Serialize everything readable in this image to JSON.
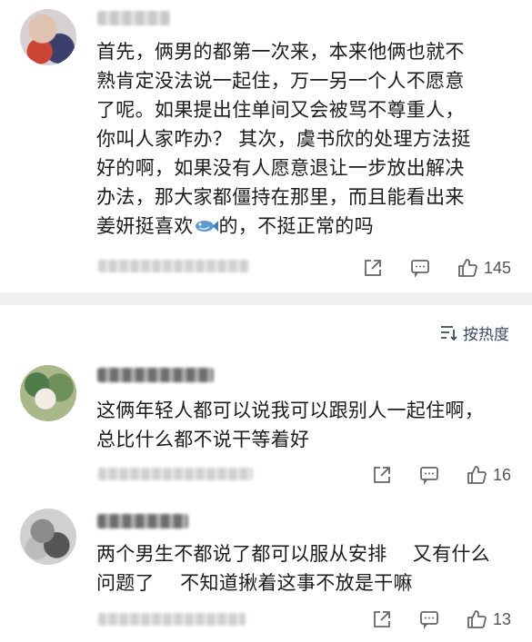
{
  "comments": [
    {
      "username": "██████",
      "text": "首先，俩男的都第一次来，本来他俩也就不\n熟肯定没法说一起住，万一另一个人不愿意\n了呢。如果提出住单间又会被骂不尊重人，\n你叫人家咋办？ 其次，虞书欣的处理方法挺\n好的啊，如果没有人愿意退让一步放出解决\n办法，那大家都僵持在那里，而且能看出来\n姜妍挺喜欢",
      "text_after_emoji": "的，不挺正常的吗",
      "emoji": "fish-emoji",
      "meta": "███████████",
      "likes": "145"
    },
    {
      "username": "███████",
      "text": "这俩年轻人都可以说我可以跟别人一起住啊，\n总比什么都不说干等着好",
      "meta": "████████████",
      "likes": "16"
    },
    {
      "username": "█████",
      "text": "两个男生不都说了都可以服从安排　 又有什么\n问题了　 不知道揪着这事不放是干嘛",
      "meta": "█████████",
      "likes": "13"
    }
  ],
  "sort": {
    "label": "按热度",
    "icon": "sort-icon"
  },
  "icons": {
    "share": "share-icon",
    "reply": "comment-icon",
    "like": "thumbs-up-icon"
  },
  "colors": {
    "accent": "#3b4a66",
    "divider": "#f0f0f0",
    "text": "#1c1c1c",
    "meta": "#999999"
  }
}
